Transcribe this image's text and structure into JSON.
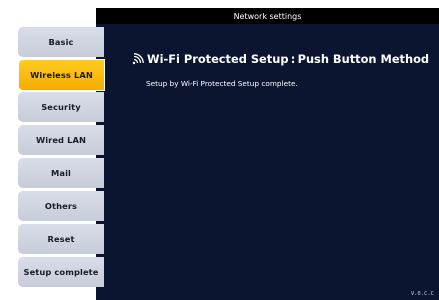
{
  "window": {
    "title": "Network settings"
  },
  "sidebar": {
    "items": [
      {
        "label": "Basic",
        "active": false
      },
      {
        "label": "Wireless LAN",
        "active": true
      },
      {
        "label": "Security",
        "active": false
      },
      {
        "label": "Wired LAN",
        "active": false
      },
      {
        "label": "Mail",
        "active": false
      },
      {
        "label": "Others",
        "active": false
      },
      {
        "label": "Reset",
        "active": false
      },
      {
        "label": "Setup complete",
        "active": false
      }
    ]
  },
  "main": {
    "heading": "Wi-Fi Protected Setup : Push Button Method",
    "heading_icon": "wifi-signal-icon",
    "message": "Setup by Wi-Fi Protected Setup complete."
  },
  "footer": {
    "version": "V.0.C.C"
  },
  "colors": {
    "panel": "#0b1530",
    "titlebar": "#000000",
    "active_item": "#f7b500",
    "inactive_item": "#d2d6e2",
    "tab_strip": "#1b2a44"
  }
}
